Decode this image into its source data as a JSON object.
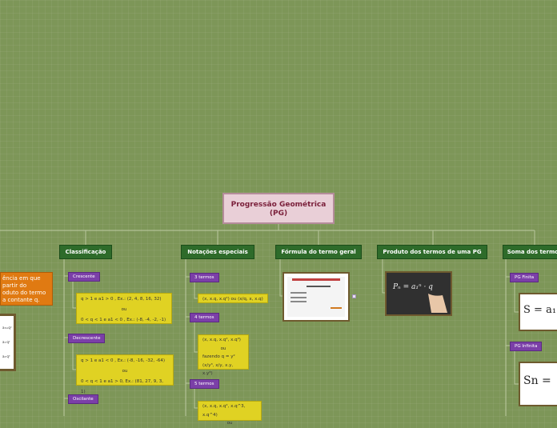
{
  "root": {
    "line1": "Progressão Geométrica",
    "line2": "(PG)"
  },
  "branches": {
    "classificacao": "Classificação",
    "notacoes": "Notações especiais",
    "formula": "Fórmula do termo geral",
    "produto": "Produto dos termos de uma PG",
    "soma": "Soma dos termos"
  },
  "orange": {
    "line1": "ência em que",
    "line2": "partir do",
    "line3": "oduto do termo",
    "line4": "a contante q."
  },
  "classificacao": {
    "crescente": "Crescente",
    "crescente_1": "q > 1 e a1 > 0 , Ex.: (2, 4, 8, 16, 32)",
    "crescente_ou": "ou",
    "crescente_2": "0 < q < 1 e a1 < 0 , Ex.: (-8, -4, -2, -1)",
    "decrescente": "Decrescente",
    "decrescente_1": "q > 1 e a1 < 0 , Ex.: (-8, -16, -32, -64)",
    "decrescente_ou": "ou",
    "decrescente_2": "0 < q < 1 e a1 > 0, Ex.: (81, 27, 9, 3, 1)",
    "oscilante": "Oscilante"
  },
  "notacoes": {
    "tres": "3 termos",
    "tres_box": "(x, x.q, x.q²) ou (x/q, x, x.q)",
    "quatro": "4 termos",
    "quatro_1": "(x, x.q, x.q², x.q³)",
    "quatro_ou": "ou",
    "quatro_2": "fazendo q = y²",
    "quatro_3": "(x/y³, x/y, x.y, x.y³)",
    "cinco": "5 termos",
    "cinco_1": "(x, x.q, x.q², x.q^3, x.q^4)",
    "cinco_ou": "ou"
  },
  "soma": {
    "finita": "PG Finita",
    "infinita": "PG Infinita"
  }
}
